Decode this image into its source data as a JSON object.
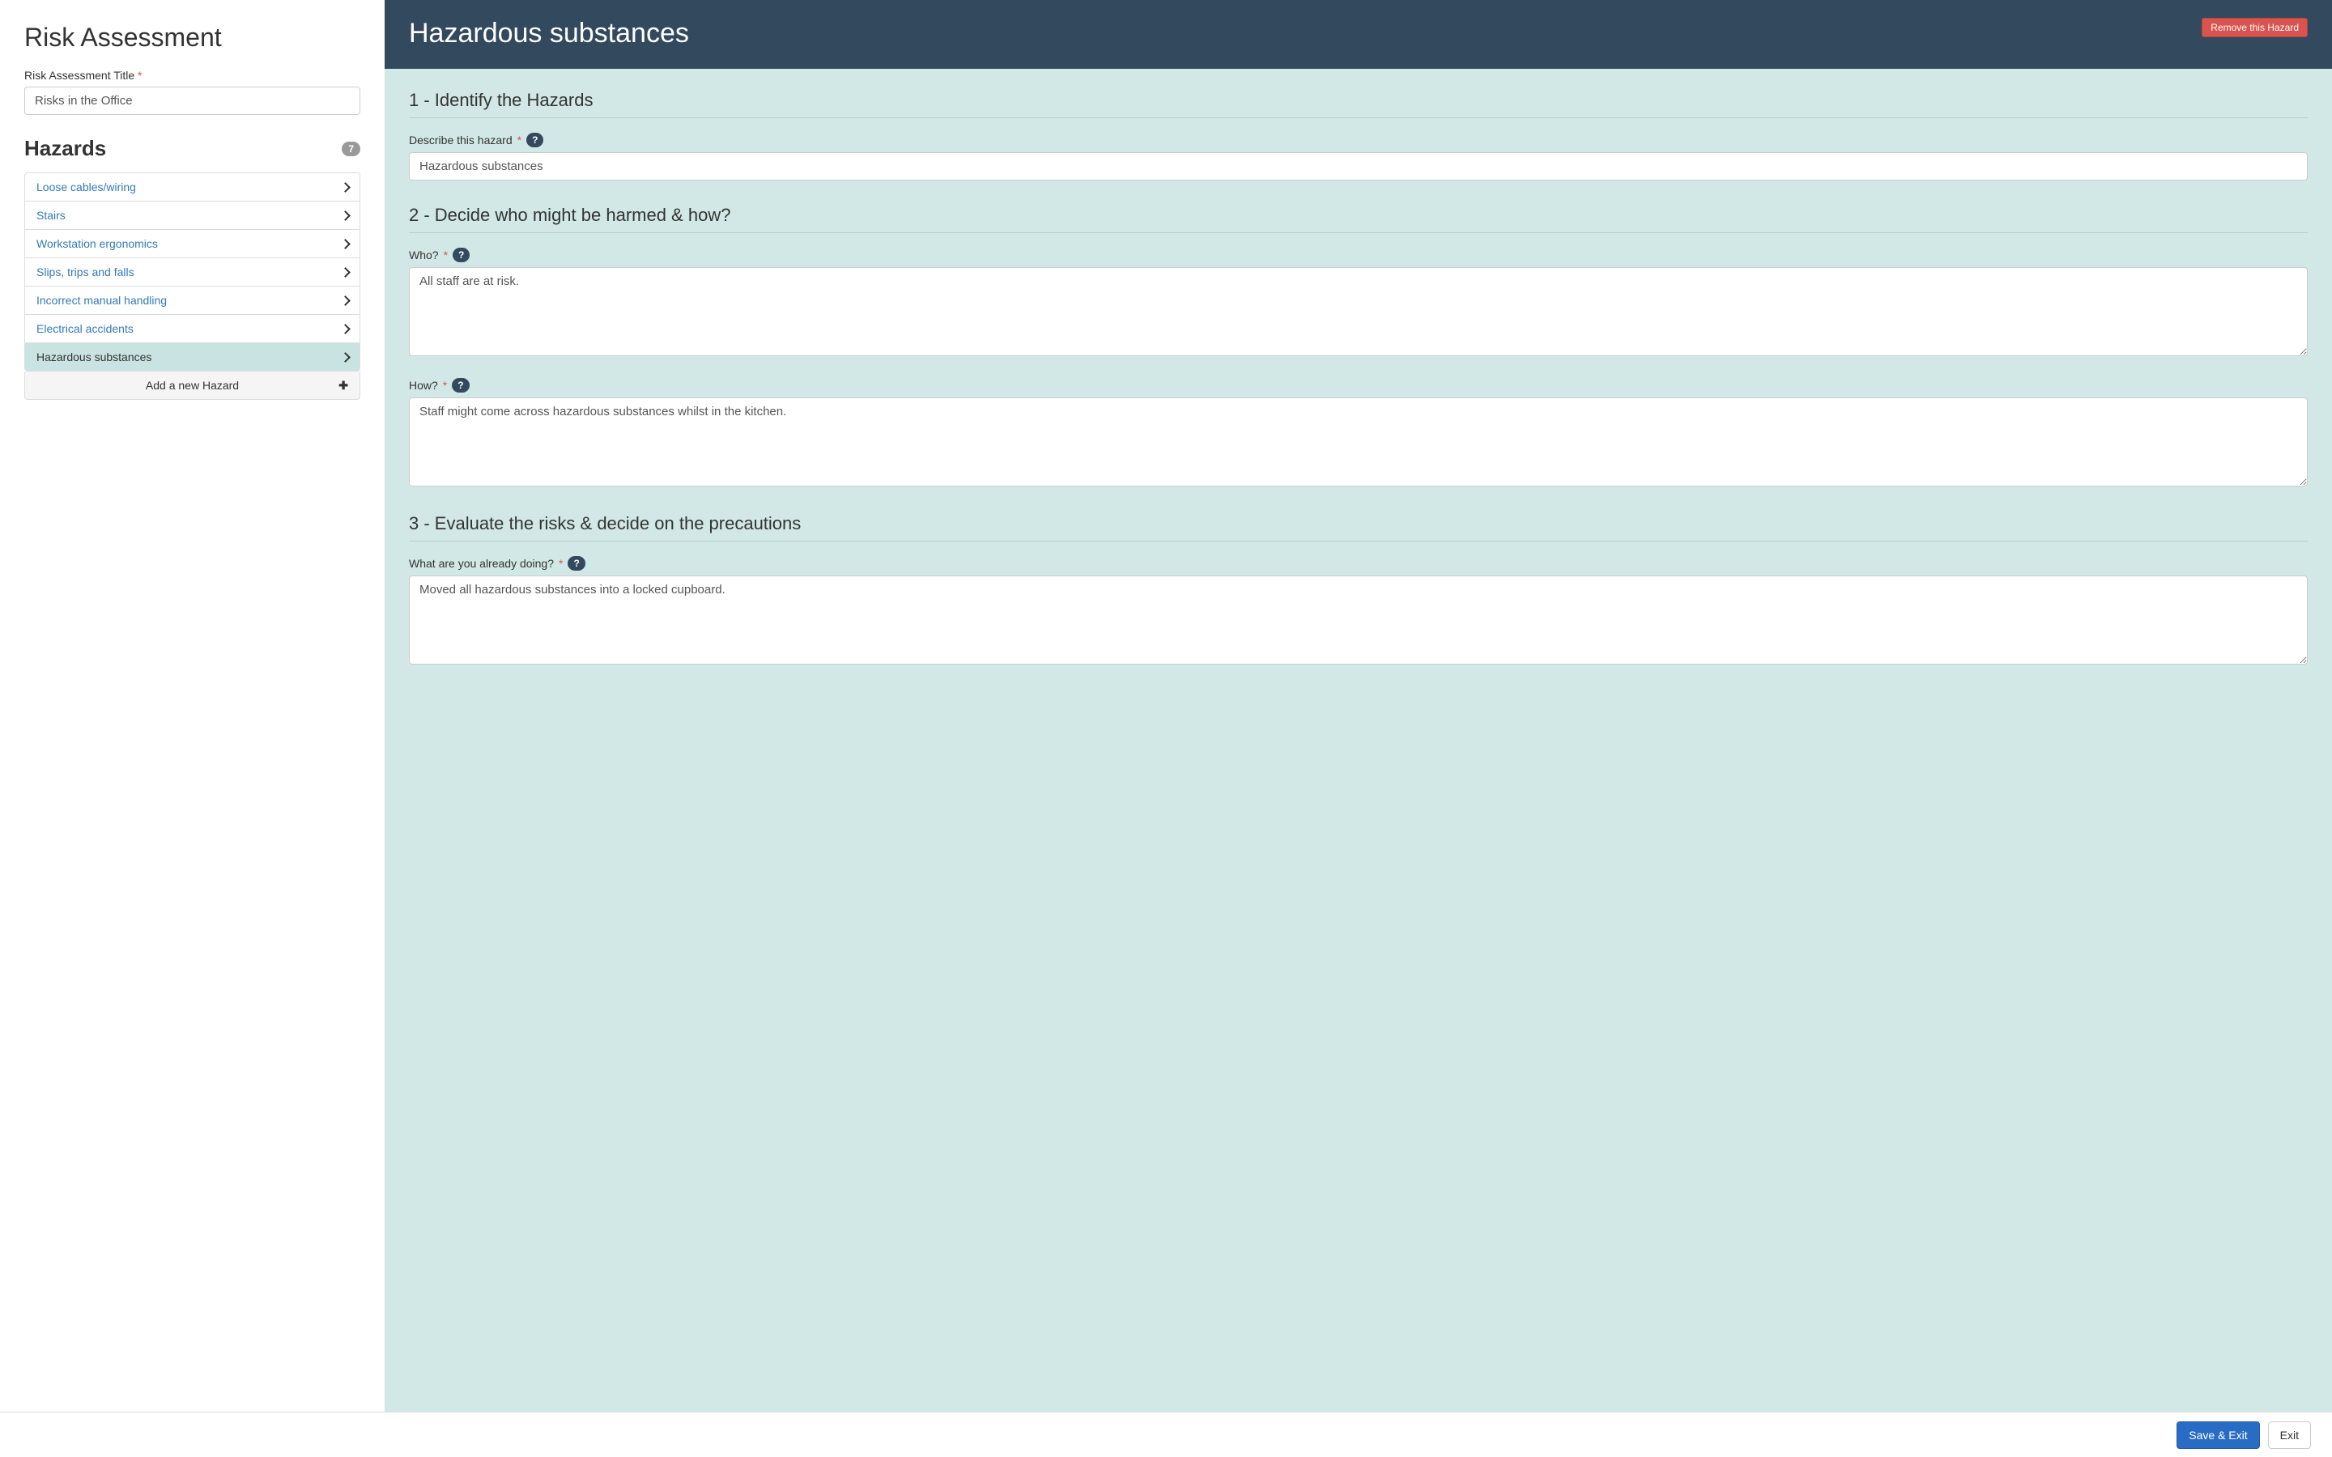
{
  "sidebar": {
    "title": "Risk Assessment",
    "title_field_label": "Risk Assessment Title",
    "title_value": "Risks in the Office",
    "hazards_heading": "Hazards",
    "hazards_count": "7",
    "hazards": [
      {
        "label": "Loose cables/wiring",
        "active": false
      },
      {
        "label": "Stairs",
        "active": false
      },
      {
        "label": "Workstation ergonomics",
        "active": false
      },
      {
        "label": "Slips, trips and falls",
        "active": false
      },
      {
        "label": "Incorrect manual handling",
        "active": false
      },
      {
        "label": "Electrical accidents",
        "active": false
      },
      {
        "label": "Hazardous substances",
        "active": true
      }
    ],
    "add_hazard_label": "Add a new Hazard"
  },
  "main": {
    "header_title": "Hazardous substances",
    "remove_button": "Remove this Hazard",
    "sections": {
      "s1": {
        "heading": "1 - Identify the Hazards",
        "describe_label": "Describe this hazard",
        "describe_value": "Hazardous substances"
      },
      "s2": {
        "heading": "2 - Decide who might be harmed & how?",
        "who_label": "Who?",
        "who_value": "All staff are at risk.",
        "how_label": "How?",
        "how_value": "Staff might come across hazardous substances whilst in the kitchen."
      },
      "s3": {
        "heading": "3 - Evaluate the risks & decide on the precautions",
        "already_label": "What are you already doing?",
        "already_value": "Moved all hazardous substances into a locked cupboard."
      }
    }
  },
  "footer": {
    "save_exit": "Save & Exit",
    "exit": "Exit"
  },
  "glyphs": {
    "help": "?",
    "plus": "✚",
    "asterisk": "*"
  }
}
